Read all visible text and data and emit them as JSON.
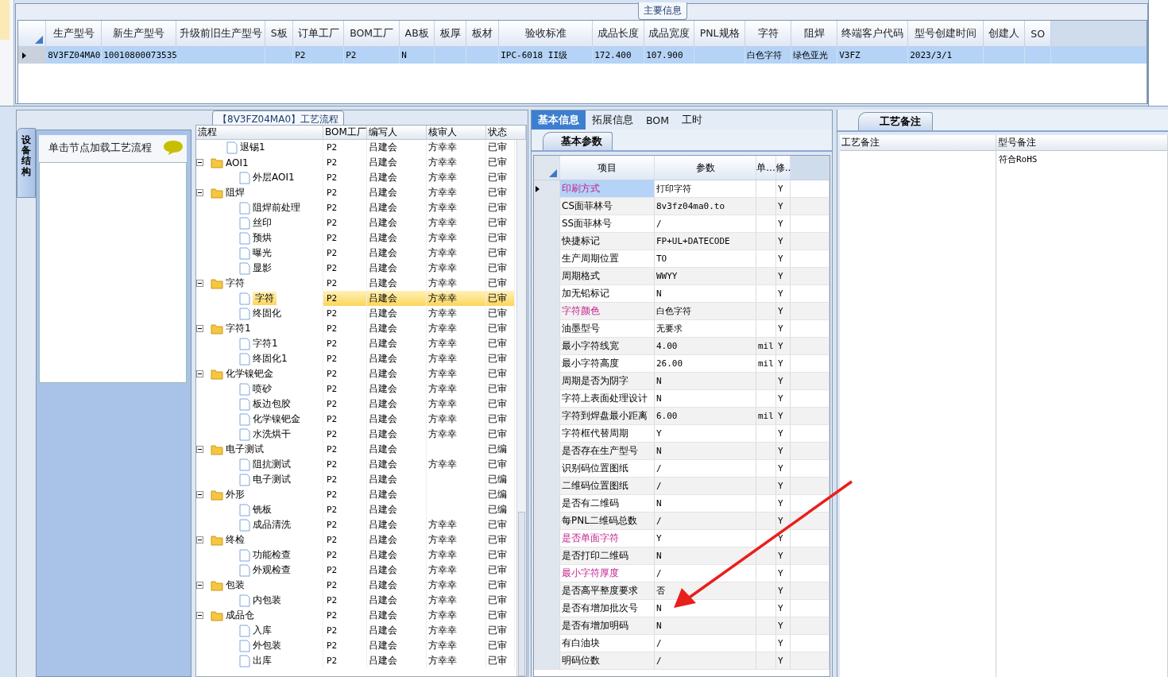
{
  "main_info": {
    "title": "主要信息",
    "columns": [
      "生产型号",
      "新生产型号",
      "升级前旧生产型号",
      "S板",
      "订单工厂",
      "BOM工厂",
      "AB板",
      "板厚",
      "板材",
      "验收标准",
      "成品长度",
      "成品宽度",
      "PNL规格",
      "字符",
      "阻焊",
      "终端客户代码",
      "型号创建时间",
      "创建人",
      "SO"
    ],
    "rows": [
      {
        "selected": true,
        "cells": [
          "8V3FZ04MA0",
          "10010800073535",
          "",
          "",
          "P2",
          "P2",
          "N",
          "",
          "",
          "IPC-6018 II级",
          "172.400",
          "107.900",
          "",
          "白色字符",
          "绿色亚光",
          "V3FZ",
          "2023/3/1",
          "",
          ""
        ]
      }
    ]
  },
  "flow": {
    "title": "【8V3FZ04MA0】工艺流程",
    "side_tab": "设备结构",
    "hint": "单击节点加载工艺流程",
    "columns": [
      "流程",
      "BOM工厂",
      "编写人",
      "核审人",
      "状态"
    ],
    "nodes": [
      {
        "kind": "step",
        "label": "退锡1",
        "bom": "P2",
        "writer": "吕建会",
        "reviewer": "方幸幸",
        "status": "已审",
        "selected": false
      },
      {
        "kind": "group",
        "label": "AOI1",
        "bom": "P2",
        "writer": "吕建会",
        "reviewer": "方幸幸",
        "status": "已审",
        "selected": false,
        "expanded": true,
        "children": [
          {
            "kind": "step",
            "label": "外层AOI1",
            "bom": "P2",
            "writer": "吕建会",
            "reviewer": "方幸幸",
            "status": "已审",
            "selected": false
          }
        ]
      },
      {
        "kind": "group",
        "label": "阻焊",
        "bom": "P2",
        "writer": "吕建会",
        "reviewer": "方幸幸",
        "status": "已审",
        "selected": false,
        "expanded": true,
        "children": [
          {
            "kind": "step",
            "label": "阻焊前处理",
            "bom": "P2",
            "writer": "吕建会",
            "reviewer": "方幸幸",
            "status": "已审",
            "selected": false
          },
          {
            "kind": "step",
            "label": "丝印",
            "bom": "P2",
            "writer": "吕建会",
            "reviewer": "方幸幸",
            "status": "已审",
            "selected": false
          },
          {
            "kind": "step",
            "label": "预烘",
            "bom": "P2",
            "writer": "吕建会",
            "reviewer": "方幸幸",
            "status": "已审",
            "selected": false
          },
          {
            "kind": "step",
            "label": "曝光",
            "bom": "P2",
            "writer": "吕建会",
            "reviewer": "方幸幸",
            "status": "已审",
            "selected": false
          },
          {
            "kind": "step",
            "label": "显影",
            "bom": "P2",
            "writer": "吕建会",
            "reviewer": "方幸幸",
            "status": "已审",
            "selected": false
          }
        ]
      },
      {
        "kind": "group",
        "label": "字符",
        "bom": "P2",
        "writer": "吕建会",
        "reviewer": "方幸幸",
        "status": "已审",
        "selected": false,
        "expanded": true,
        "children": [
          {
            "kind": "step",
            "label": "字符",
            "bom": "P2",
            "writer": "吕建会",
            "reviewer": "方幸幸",
            "status": "已审",
            "selected": true
          },
          {
            "kind": "step",
            "label": "终固化",
            "bom": "P2",
            "writer": "吕建会",
            "reviewer": "方幸幸",
            "status": "已审",
            "selected": false
          }
        ]
      },
      {
        "kind": "group",
        "label": "字符1",
        "bom": "P2",
        "writer": "吕建会",
        "reviewer": "方幸幸",
        "status": "已审",
        "selected": false,
        "expanded": true,
        "children": [
          {
            "kind": "step",
            "label": "字符1",
            "bom": "P2",
            "writer": "吕建会",
            "reviewer": "方幸幸",
            "status": "已审",
            "selected": false
          },
          {
            "kind": "step",
            "label": "终固化1",
            "bom": "P2",
            "writer": "吕建会",
            "reviewer": "方幸幸",
            "status": "已审",
            "selected": false
          }
        ]
      },
      {
        "kind": "group",
        "label": "化学镍钯金",
        "bom": "P2",
        "writer": "吕建会",
        "reviewer": "方幸幸",
        "status": "已审",
        "selected": false,
        "expanded": true,
        "children": [
          {
            "kind": "step",
            "label": "喷砂",
            "bom": "P2",
            "writer": "吕建会",
            "reviewer": "方幸幸",
            "status": "已审",
            "selected": false
          },
          {
            "kind": "step",
            "label": "板边包胶",
            "bom": "P2",
            "writer": "吕建会",
            "reviewer": "方幸幸",
            "status": "已审",
            "selected": false
          },
          {
            "kind": "step",
            "label": "化学镍钯金",
            "bom": "P2",
            "writer": "吕建会",
            "reviewer": "方幸幸",
            "status": "已审",
            "selected": false
          },
          {
            "kind": "step",
            "label": "水洗烘干",
            "bom": "P2",
            "writer": "吕建会",
            "reviewer": "方幸幸",
            "status": "已审",
            "selected": false
          }
        ]
      },
      {
        "kind": "group",
        "label": "电子测试",
        "bom": "P2",
        "writer": "吕建会",
        "status": "已编",
        "selected": false,
        "expanded": true,
        "children": [
          {
            "kind": "step",
            "label": "阻抗测试",
            "bom": "P2",
            "writer": "吕建会",
            "reviewer": "方幸幸",
            "status": "已审",
            "selected": false
          },
          {
            "kind": "step",
            "label": "电子测试",
            "bom": "P2",
            "writer": "吕建会",
            "status": "已编",
            "selected": false
          }
        ]
      },
      {
        "kind": "group",
        "label": "外形",
        "bom": "P2",
        "writer": "吕建会",
        "status": "已编",
        "selected": false,
        "expanded": true,
        "children": [
          {
            "kind": "step",
            "label": "铣板",
            "bom": "P2",
            "writer": "吕建会",
            "status": "已编",
            "selected": false
          },
          {
            "kind": "step",
            "label": "成品清洗",
            "bom": "P2",
            "writer": "吕建会",
            "reviewer": "方幸幸",
            "status": "已审",
            "selected": false
          }
        ]
      },
      {
        "kind": "group",
        "label": "终检",
        "bom": "P2",
        "writer": "吕建会",
        "reviewer": "方幸幸",
        "status": "已审",
        "selected": false,
        "expanded": true,
        "children": [
          {
            "kind": "step",
            "label": "功能检查",
            "bom": "P2",
            "writer": "吕建会",
            "reviewer": "方幸幸",
            "status": "已审",
            "selected": false
          },
          {
            "kind": "step",
            "label": "外观检查",
            "bom": "P2",
            "writer": "吕建会",
            "reviewer": "方幸幸",
            "status": "已审",
            "selected": false
          }
        ]
      },
      {
        "kind": "group",
        "label": "包装",
        "bom": "P2",
        "writer": "吕建会",
        "reviewer": "方幸幸",
        "status": "已审",
        "selected": false,
        "expanded": true,
        "children": [
          {
            "kind": "step",
            "label": "内包装",
            "bom": "P2",
            "writer": "吕建会",
            "reviewer": "方幸幸",
            "status": "已审",
            "selected": false
          }
        ]
      },
      {
        "kind": "group",
        "label": "成品仓",
        "bom": "P2",
        "writer": "吕建会",
        "reviewer": "方幸幸",
        "status": "已审",
        "selected": false,
        "expanded": true,
        "children": [
          {
            "kind": "step",
            "label": "入库",
            "bom": "P2",
            "writer": "吕建会",
            "reviewer": "方幸幸",
            "status": "已审",
            "selected": false
          },
          {
            "kind": "step",
            "label": "外包装",
            "bom": "P2",
            "writer": "吕建会",
            "reviewer": "方幸幸",
            "status": "已审",
            "selected": false
          },
          {
            "kind": "step",
            "label": "出库",
            "bom": "P2",
            "writer": "吕建会",
            "reviewer": "方幸幸",
            "status": "已审",
            "selected": false
          }
        ]
      }
    ]
  },
  "detail": {
    "tabs": [
      {
        "label": "基本信息",
        "selected": true
      },
      {
        "label": "拓展信息",
        "selected": false
      },
      {
        "label": "BOM",
        "selected": false
      },
      {
        "label": "工时",
        "selected": false
      }
    ],
    "sub_tab": "基本参数",
    "columns": [
      "项目",
      "参数",
      "单...",
      "修.."
    ],
    "rows": [
      {
        "item": "印刷方式",
        "value": "打印字符",
        "unit": "",
        "mod": "Y",
        "flagged": true,
        "selected": true
      },
      {
        "item": "CS面菲林号",
        "value": "8v3fz04ma0.to",
        "unit": "",
        "mod": "Y",
        "flagged": false,
        "selected": false
      },
      {
        "item": "SS面菲林号",
        "value": "/",
        "unit": "",
        "mod": "Y",
        "flagged": false,
        "selected": false
      },
      {
        "item": "快捷标记",
        "value": "FP+UL+DATECODE",
        "unit": "",
        "mod": "Y",
        "flagged": false,
        "selected": false
      },
      {
        "item": "生产周期位置",
        "value": "TO",
        "unit": "",
        "mod": "Y",
        "flagged": false,
        "selected": false
      },
      {
        "item": "周期格式",
        "value": "WWYY",
        "unit": "",
        "mod": "Y",
        "flagged": false,
        "selected": false
      },
      {
        "item": "加无铅标记",
        "value": "N",
        "unit": "",
        "mod": "Y",
        "flagged": false,
        "selected": false
      },
      {
        "item": "字符颜色",
        "value": "白色字符",
        "unit": "",
        "mod": "Y",
        "flagged": true,
        "selected": false
      },
      {
        "item": "油墨型号",
        "value": "无要求",
        "unit": "",
        "mod": "Y",
        "flagged": false,
        "selected": false
      },
      {
        "item": "最小字符线宽",
        "value": "4.00",
        "unit": "mil",
        "mod": "Y",
        "flagged": false,
        "selected": false
      },
      {
        "item": "最小字符高度",
        "value": "26.00",
        "unit": "mil",
        "mod": "Y",
        "flagged": false,
        "selected": false
      },
      {
        "item": "周期是否为阴字",
        "value": "N",
        "unit": "",
        "mod": "Y",
        "flagged": false,
        "selected": false
      },
      {
        "item": "字符上表面处理设计",
        "value": "N",
        "unit": "",
        "mod": "Y",
        "flagged": false,
        "selected": false
      },
      {
        "item": "字符到焊盘最小距离",
        "value": "6.00",
        "unit": "mil",
        "mod": "Y",
        "flagged": false,
        "selected": false
      },
      {
        "item": "字符框代替周期",
        "value": "Y",
        "unit": "",
        "mod": "Y",
        "flagged": false,
        "selected": false
      },
      {
        "item": "是否存在生产型号",
        "value": "N",
        "unit": "",
        "mod": "Y",
        "flagged": false,
        "selected": false
      },
      {
        "item": "识别码位置图纸",
        "value": "/",
        "unit": "",
        "mod": "Y",
        "flagged": false,
        "selected": false
      },
      {
        "item": "二维码位置图纸",
        "value": "/",
        "unit": "",
        "mod": "Y",
        "flagged": false,
        "selected": false
      },
      {
        "item": "是否有二维码",
        "value": "N",
        "unit": "",
        "mod": "Y",
        "flagged": false,
        "selected": false
      },
      {
        "item": "每PNL二维码总数",
        "value": "/",
        "unit": "",
        "mod": "Y",
        "flagged": false,
        "selected": false
      },
      {
        "item": "是否单面字符",
        "value": "Y",
        "unit": "",
        "mod": "Y",
        "flagged": true,
        "selected": false
      },
      {
        "item": "是否打印二维码",
        "value": "N",
        "unit": "",
        "mod": "Y",
        "flagged": false,
        "selected": false
      },
      {
        "item": "最小字符厚度",
        "value": "/",
        "unit": "",
        "mod": "Y",
        "flagged": true,
        "selected": false
      },
      {
        "item": "是否高平整度要求",
        "value": "否",
        "unit": "",
        "mod": "Y",
        "flagged": false,
        "selected": false
      },
      {
        "item": "是否有增加批次号",
        "value": "N",
        "unit": "",
        "mod": "Y",
        "flagged": false,
        "selected": false
      },
      {
        "item": "是否有增加明码",
        "value": "N",
        "unit": "",
        "mod": "Y",
        "flagged": false,
        "selected": false
      },
      {
        "item": "有白油块",
        "value": "/",
        "unit": "",
        "mod": "Y",
        "flagged": false,
        "selected": false
      },
      {
        "item": "明码位数",
        "value": "/",
        "unit": "",
        "mod": "Y",
        "flagged": false,
        "selected": false
      }
    ]
  },
  "notes": {
    "tab": "工艺备注",
    "columns": [
      "工艺备注",
      "型号备注"
    ],
    "model_note": "符合RoHS"
  }
}
